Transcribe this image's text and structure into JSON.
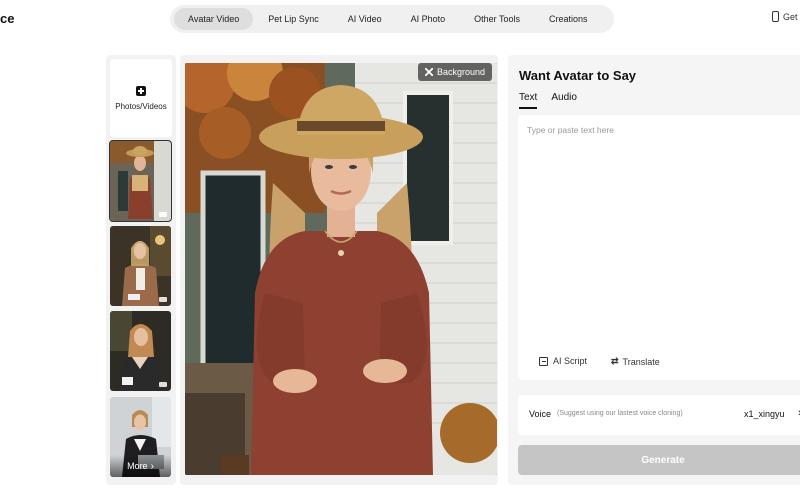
{
  "header": {
    "brand_fragment": "ce",
    "nav": [
      {
        "label": "Avatar Video",
        "active": true
      },
      {
        "label": "Pet Lip Sync",
        "active": false
      },
      {
        "label": "AI Video",
        "active": false
      },
      {
        "label": "AI Photo",
        "active": false
      },
      {
        "label": "Other Tools",
        "active": false
      },
      {
        "label": "Creations",
        "active": false
      }
    ],
    "right_label": "Get",
    "right_icon": "phone-icon"
  },
  "thumbnails": {
    "upload_label": "Photos/Videos",
    "upload_icon": "plus-icon",
    "items": [
      {
        "selected": true,
        "icon": "video-camera-icon"
      },
      {
        "selected": false,
        "icon": "video-camera-icon"
      },
      {
        "selected": false,
        "icon": "video-camera-icon"
      },
      {
        "selected": false,
        "icon": "video-camera-icon"
      }
    ],
    "more_label": "More"
  },
  "preview": {
    "background_button": "Background",
    "background_icon": "expand-icon"
  },
  "panel": {
    "title": "Want Avatar to Say",
    "tabs": [
      {
        "label": "Text",
        "active": true
      },
      {
        "label": "Audio",
        "active": false
      }
    ],
    "text_placeholder": "Type or paste text here",
    "ai_script_label": "AI Script",
    "translate_label": "Translate",
    "voice_label": "Voice",
    "voice_hint": "(Suggest using our lastest voice cloning)",
    "voice_value": "x1_xingyu",
    "generate_label": "Generate"
  },
  "colors": {
    "nav_bg": "#f0f0f0",
    "nav_active": "#dedede",
    "panel_bg": "#f5f5f5",
    "generate_disabled": "#c5c5c5"
  }
}
